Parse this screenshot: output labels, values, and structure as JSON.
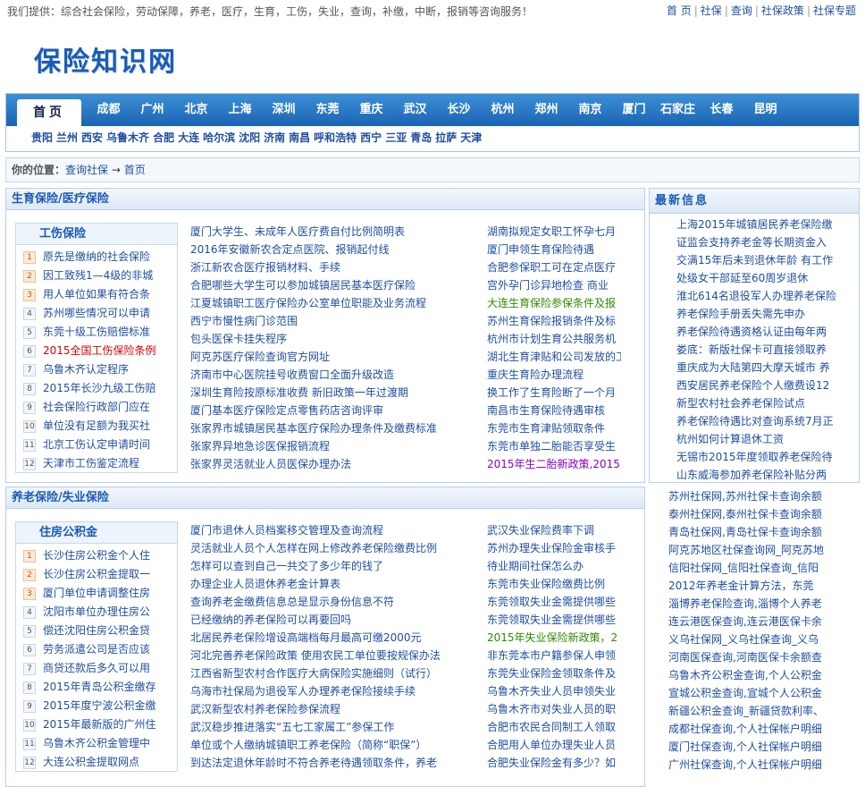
{
  "topbar": {
    "intro": "我们提供：综合社会保险，劳动保障，养老，医疗，生育，工伤，失业，查询，补缴，中断，报销等咨询服务！",
    "links": [
      "首 页",
      "社保",
      "查询",
      "社保政策",
      "社保专题"
    ]
  },
  "logo": {
    "text": "保险知识网"
  },
  "nav": {
    "home": "首页",
    "cities": [
      "成都",
      "广州",
      "北京",
      "上海",
      "深圳",
      "东莞",
      "重庆",
      "武汉",
      "长沙",
      "杭州",
      "郑州",
      "南京",
      "厦门",
      "石家庄",
      "长春",
      "昆明"
    ],
    "sub_cities": [
      "贵阳",
      "兰州",
      "西安",
      "乌鲁木齐",
      "合肥",
      "大连",
      "哈尔滨",
      "沈阳",
      "济南",
      "南昌",
      "呼和浩特",
      "西宁",
      "三亚",
      "青岛",
      "拉萨",
      "天津"
    ]
  },
  "breadcrumb": {
    "label": "你的位置：",
    "items": [
      "查询社保",
      "→",
      "首页"
    ]
  },
  "section1": {
    "title": "生育保险/医疗保险",
    "side_title": "工伤保险",
    "side_items": [
      {
        "num": "1",
        "text": "原先是缴纳的社会保险"
      },
      {
        "num": "2",
        "text": "因工致残1—4级的非城"
      },
      {
        "num": "3",
        "text": "用人单位如果有符合条"
      },
      {
        "num": "4",
        "text": "苏州哪些情况可以申请"
      },
      {
        "num": "5",
        "text": "东莞十级工伤赔偿标准"
      },
      {
        "num": "6",
        "text": "2015全国工伤保险条例"
      },
      {
        "num": "7",
        "text": "乌鲁木齐认定程序"
      },
      {
        "num": "8",
        "text": "2015年长沙九级工伤赔"
      },
      {
        "num": "9",
        "text": "社会保险行政部门应在"
      },
      {
        "num": "10",
        "text": "单位没有足额为我买社"
      },
      {
        "num": "11",
        "text": "北京工伤认定申请时间"
      },
      {
        "num": "12",
        "text": "天津市工伤鉴定流程"
      }
    ],
    "col1": [
      "厦门大学生、未成年人医疗费自付比例简明表",
      "2016年安徽新农合定点医院、报销起付线",
      "浙江新农合医疗报销材料、手续",
      "合肥哪些大学生可以参加城镇居民基本医疗保险",
      "江夏城镇职工医疗保险办公室单位职能及业务流程",
      "西宁市慢性病门诊范围",
      "包头医保卡挂失程序",
      "阿克苏医疗保险查询官方网址",
      "济南市中心医院挂号收费窗口全面升级改造",
      "深圳生育险按原标准收费 新旧政策一年过渡期",
      "厦门基本医疗保险定点零售药店咨询评审",
      "张家界市城镇居民基本医疗保险办理条件及缴费标准",
      "张家界异地急诊医保报销流程",
      "张家界灵活就业人员医保办理办法"
    ],
    "col2": [
      "湖南拟规定女职工怀孕七月",
      "厦门申领生育保险待遇",
      "合肥参保职工可在定点医疗",
      "宫外孕门诊异地检查 商业",
      "大连生育保险参保条件及报",
      "苏州生育保险报销条件及标",
      "杭州市计划生育公共服务机",
      "湖北生育津贴和公司发放的工资",
      "重庆生育险办理流程",
      "换工作了生育险断了一个月",
      "南昌市生育保险待遇审核",
      "东莞市生育津贴领取条件",
      "东莞市单独二胎能否享受生",
      "2015年生二胎新政策,2015"
    ]
  },
  "section2": {
    "title": "养老保险/失业保险",
    "side_title": "住房公积金",
    "side_items": [
      {
        "num": "1",
        "text": "长沙住房公积金个人住"
      },
      {
        "num": "2",
        "text": "长沙住房公积金提取一"
      },
      {
        "num": "3",
        "text": "厦门单位申请调整住房"
      },
      {
        "num": "4",
        "text": "沈阳市单位办理住房公"
      },
      {
        "num": "5",
        "text": "偿还沈阳住房公积金贷"
      },
      {
        "num": "6",
        "text": "劳务派遣公司是否应该"
      },
      {
        "num": "7",
        "text": "商贷还款后多久可以用"
      },
      {
        "num": "8",
        "text": "2015年青岛公积金缴存"
      },
      {
        "num": "9",
        "text": "2015年度宁波公积金缴"
      },
      {
        "num": "10",
        "text": "2015年最新版的广州住"
      },
      {
        "num": "11",
        "text": "乌鲁木齐公积金管理中"
      },
      {
        "num": "12",
        "text": "大连公积金提取网点"
      }
    ],
    "col1": [
      "厦门市退休人员档案移交管理及查询流程",
      "灵活就业人员个人怎样在网上修改养老保险缴费比例",
      "怎样可以查到自己一共交了多少年的钱了",
      "办理企业人员退休养老金计算表",
      "查询养老金缴费信息总是显示身份信息不符",
      "已经缴纳的养老保险可以再要回吗",
      "北居民养老保险增设高端档每月最高可缴2000元",
      "河北完善养老保险政策 使用农民工单位要按规保办法",
      "江西省新型农村合作医疗大病保险实施细则（试行）",
      "乌海市社保局为退役军人办理养老保险接续手续",
      "武汉新型农村养老保险参保流程",
      "武汉稳步推进落实“五七工家属工”参保工作",
      "单位或个人缴纳城镇职工养老保险（简称“职保”）",
      "到达法定退休年龄时不符合养老待遇领取条件，养老"
    ],
    "col2": [
      "武汉失业保险费率下调",
      "苏州办理失业保险金审核手",
      "待业期间社保怎么办",
      "东莞市失业保险缴费比例",
      "东莞领取失业金需提供哪些",
      "东莞领取失业金需提供哪些",
      "2015年失业保险新政策，2",
      "非东莞本市户籍参保人申领",
      "东莞失业保险金领取条件及",
      "乌鲁木齐失业人员申领失业",
      "乌鲁木齐市对失业人员的职",
      "合肥市农民合同制工人领取",
      "合肥用人单位办理失业人员",
      "合肥失业保险金有多少？如"
    ]
  },
  "news": {
    "title": "最新信息",
    "items": [
      "上海2015年城镇居民养老保险缴",
      "证监会支持养老金等长期资金入",
      "交满15年后未到退休年龄 有工作",
      "处级女干部延至60周岁退休",
      "淮北614名退役军人办理养老保险",
      "养老保险手册丢失需先申办",
      "养老保险待遇资格认证由每年两",
      "娄底：新版社保卡可直接领取养",
      "重庆成为大陆第四大摩天城市 养",
      "西安居民养老保险个人缴费设12",
      "新型农村社会养老保险试点",
      "养老保险待遇比对查询系统7月正",
      "杭州如何计算退休工资",
      "无锡市2015年度领取养老保险待",
      "山东威海参加养老保险补贴分两"
    ]
  },
  "right_list": [
    "苏州社保网,苏州社保卡查询余额",
    "泰州社保网,泰州社保卡查询余额",
    "青岛社保网,青岛社保卡查询余额",
    "阿克苏地区社保查询网_阿克苏地",
    "信阳社保网_信阳社保查询_信阳",
    "2012年养老金计算方法，东莞",
    "淄博养老保险查询,淄博个人养老",
    "连云港医保查询,连云港医保卡余",
    "义乌社保网_义乌社保查询_义乌",
    "河南医保查询,河南医保卡余额查",
    "乌鲁木齐公积金查询,个人公积金",
    "宣城公积金查询,宣城个人公积金",
    "新疆公积金查询_新疆贷款利率、",
    "成都社保查询,个人社保帐户明细",
    "厦门社保查询,个人社保帐户明细",
    "广州社保查询,个人社保帐户明细"
  ]
}
